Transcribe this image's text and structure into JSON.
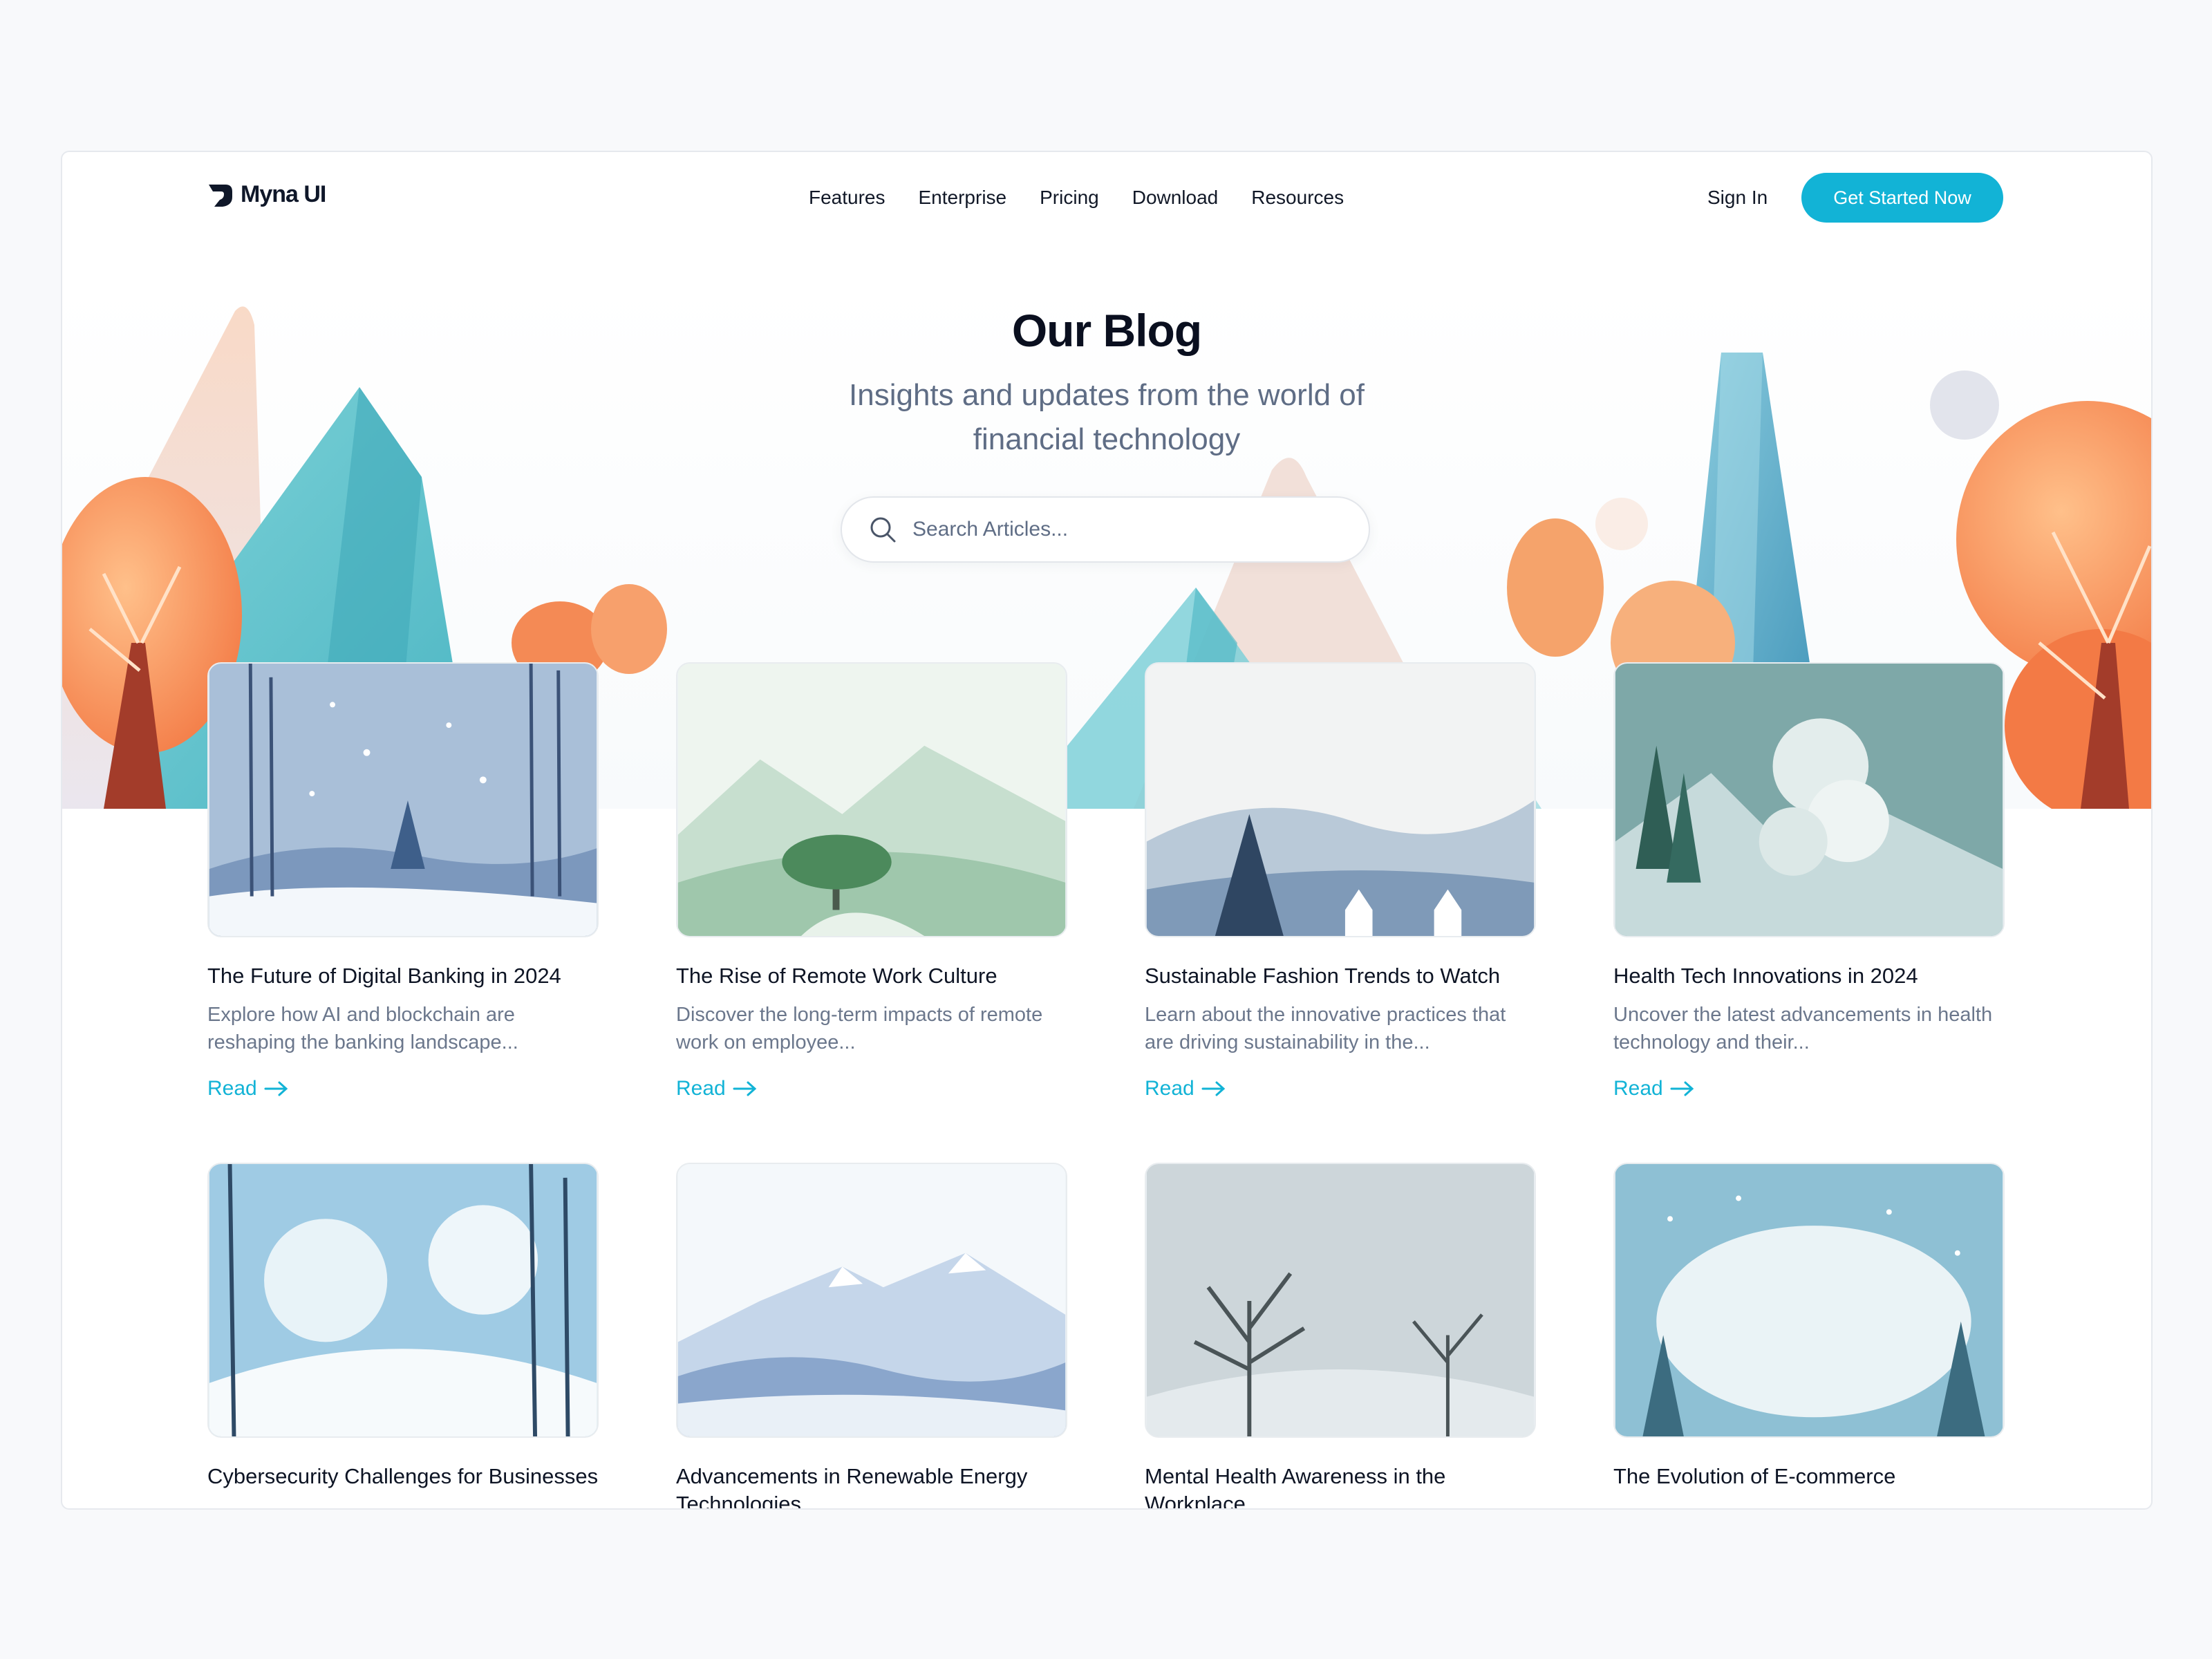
{
  "brand": {
    "name": "Myna UI",
    "accent": "#12b3d6"
  },
  "nav": {
    "links": [
      "Features",
      "Enterprise",
      "Pricing",
      "Download",
      "Resources"
    ],
    "sign_in": "Sign In",
    "cta": "Get Started Now"
  },
  "hero": {
    "title": "Our Blog",
    "subtitle": "Insights and updates from the world of financial technology"
  },
  "search": {
    "placeholder": "Search Articles...",
    "icon": "search-icon"
  },
  "posts": [
    {
      "title": "The Future of Digital Banking in 2024",
      "excerpt": "Explore how AI and blockchain are reshaping the banking landscape...",
      "cta": "Read"
    },
    {
      "title": "The Rise of Remote Work Culture",
      "excerpt": "Discover the long-term impacts of remote work on employee...",
      "cta": "Read"
    },
    {
      "title": "Sustainable Fashion Trends to Watch",
      "excerpt": "Learn about the innovative practices that are driving sustainability in the...",
      "cta": "Read"
    },
    {
      "title": "Health Tech Innovations in 2024",
      "excerpt": "Uncover the latest advancements in health technology and their...",
      "cta": "Read"
    },
    {
      "title": "Cybersecurity Challenges for Businesses",
      "excerpt": "",
      "cta": ""
    },
    {
      "title": "Advancements in Renewable Energy Technologies",
      "excerpt": "",
      "cta": ""
    },
    {
      "title": "Mental Health Awareness in the Workplace",
      "excerpt": "",
      "cta": ""
    },
    {
      "title": "The Evolution of E-commerce",
      "excerpt": "",
      "cta": ""
    }
  ]
}
